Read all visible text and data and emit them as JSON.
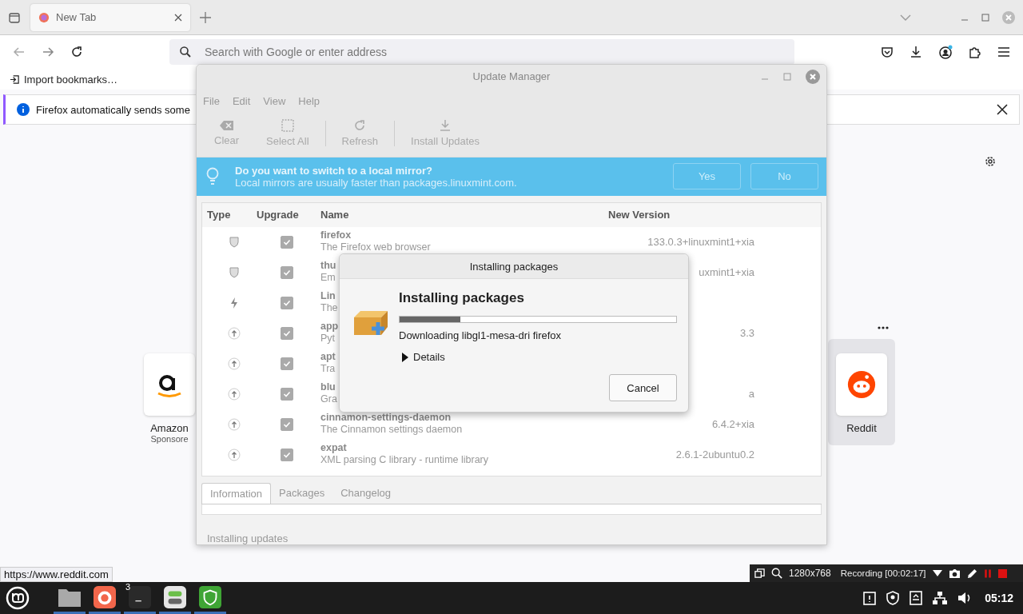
{
  "browser": {
    "tabs": [
      {
        "label": "New Tab",
        "selected": true
      }
    ],
    "search": {
      "placeholder": "Search with Google or enter address"
    },
    "bookmarks": [
      "Import bookmarks…"
    ],
    "notification": "Firefox automatically sends some",
    "shortcuts": [
      {
        "kind": "amazon",
        "title": "Amazon",
        "subtitle": "Sponsore",
        "hovered": false
      },
      {
        "kind": "reddit",
        "title": "Reddit",
        "hovered": true
      }
    ],
    "status_url": "https://www.reddit.com"
  },
  "update_manager": {
    "title": "Update Manager",
    "menu": [
      "File",
      "Edit",
      "View",
      "Help"
    ],
    "toolbar": [
      {
        "kind": "clear",
        "label": "Clear"
      },
      {
        "kind": "select",
        "label": "Select All"
      },
      {
        "kind": "refresh",
        "label": "Refresh"
      },
      {
        "kind": "install",
        "label": "Install Updates"
      }
    ],
    "infobar": {
      "title": "Do you want to switch to a local mirror?",
      "text": "Local mirrors are usually faster than packages.linuxmint.com.",
      "buttons": [
        "Yes",
        "No"
      ]
    },
    "columns": [
      "Type",
      "Upgrade",
      "Name",
      "New Version"
    ],
    "rows": [
      {
        "kind": "security",
        "checked": true,
        "name": "firefox",
        "description": "The Firefox web browser",
        "version": "133.0.3+linuxmint1+xia"
      },
      {
        "kind": "security",
        "checked": true,
        "name": "thu",
        "description": "Em",
        "version": "uxmint1+xia"
      },
      {
        "kind": "kernel",
        "checked": true,
        "name": "Lin",
        "description": "The"
      },
      {
        "kind": "upgrade",
        "checked": true,
        "name": "app",
        "description": "Pyt",
        "version": "3.3"
      },
      {
        "kind": "upgrade",
        "checked": true,
        "name": "apt",
        "description": "Tra"
      },
      {
        "kind": "upgrade",
        "checked": true,
        "name": "blu",
        "description": "Gra",
        "version": "a"
      },
      {
        "kind": "upgrade",
        "checked": true,
        "name": "cinnamon-settings-daemon",
        "description": "The Cinnamon settings daemon",
        "version": "6.4.2+xia"
      },
      {
        "kind": "upgrade",
        "checked": true,
        "name": "expat",
        "description": "XML parsing C library - runtime library",
        "version": "2.6.1-2ubuntu0.2"
      }
    ],
    "tabs": [
      {
        "label": "Information",
        "selected": true
      },
      {
        "label": "Packages",
        "selected": false
      },
      {
        "label": "Changelog",
        "selected": false
      }
    ],
    "status": "Installing updates"
  },
  "dialog": {
    "title": "Installing packages",
    "heading": "Installing packages",
    "level": 0.22,
    "message": "Downloading libgl1-mesa-dri firefox",
    "expander": {
      "label": "Details",
      "expanded": false
    },
    "button": "Cancel"
  },
  "recorder": {
    "size": "1280x768",
    "status": "Recording [00:02:17]"
  },
  "taskbar": {
    "apps": [
      {
        "kind": "files"
      },
      {
        "kind": "firefox"
      },
      {
        "kind": "terminal",
        "badge": "3"
      },
      {
        "kind": "settings"
      },
      {
        "kind": "shield"
      }
    ],
    "clock": "05:12"
  }
}
